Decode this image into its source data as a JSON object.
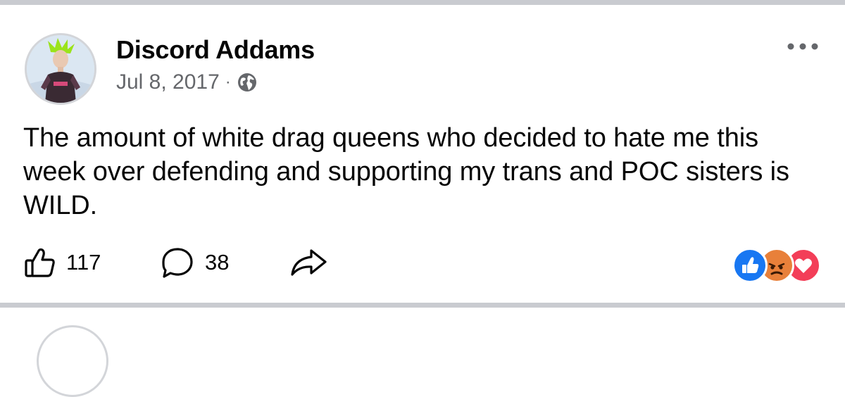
{
  "post": {
    "author": "Discord Addams",
    "date": "Jul 8, 2017",
    "separator": "·",
    "privacy_icon": "globe-icon",
    "text": "The amount of white drag queens who decided to hate me this week over defending and supporting my trans and POC sisters is WILD."
  },
  "actions": {
    "like_count": "117",
    "comment_count": "38",
    "like_icon": "thumbs-up-icon",
    "comment_icon": "comment-bubble-icon",
    "share_icon": "share-arrow-icon"
  },
  "reactions": [
    "like",
    "angry",
    "love"
  ],
  "colors": {
    "text": "#050505",
    "secondary": "#65676b",
    "divider": "#c9cbd0",
    "like": "#1877f2",
    "angry": "#e8803a",
    "love": "#f33e58"
  }
}
